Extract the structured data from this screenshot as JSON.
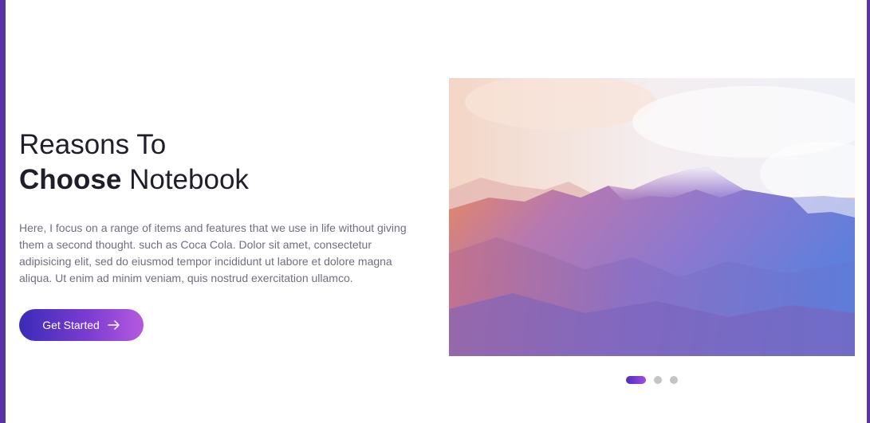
{
  "hero": {
    "title_line1": "Reasons To",
    "title_strong": "Choose",
    "title_rest": "Notebook",
    "description": "Here, I focus on a range of items and features that we use in life without giving them a second thought. such as Coca Cola. Dolor sit amet, consectetur adipisicing elit, sed do eiusmod tempor incididunt ut labore et dolore magna aliqua. Ut enim ad minim veniam, quis nostrud exercitation ullamco.",
    "cta_label": "Get Started",
    "cta_icon": "arrow-right-icon"
  },
  "slider": {
    "image": "mountain-landscape-image",
    "total_slides": 3,
    "active_slide": 1
  },
  "colors": {
    "accent_start": "#3b2bb8",
    "accent_end": "#b45ae0",
    "frame_border": "#5a34a3",
    "heading": "#1f1f2b",
    "body_text": "#6f6f7f",
    "dot_inactive": "#c4c4c4"
  }
}
